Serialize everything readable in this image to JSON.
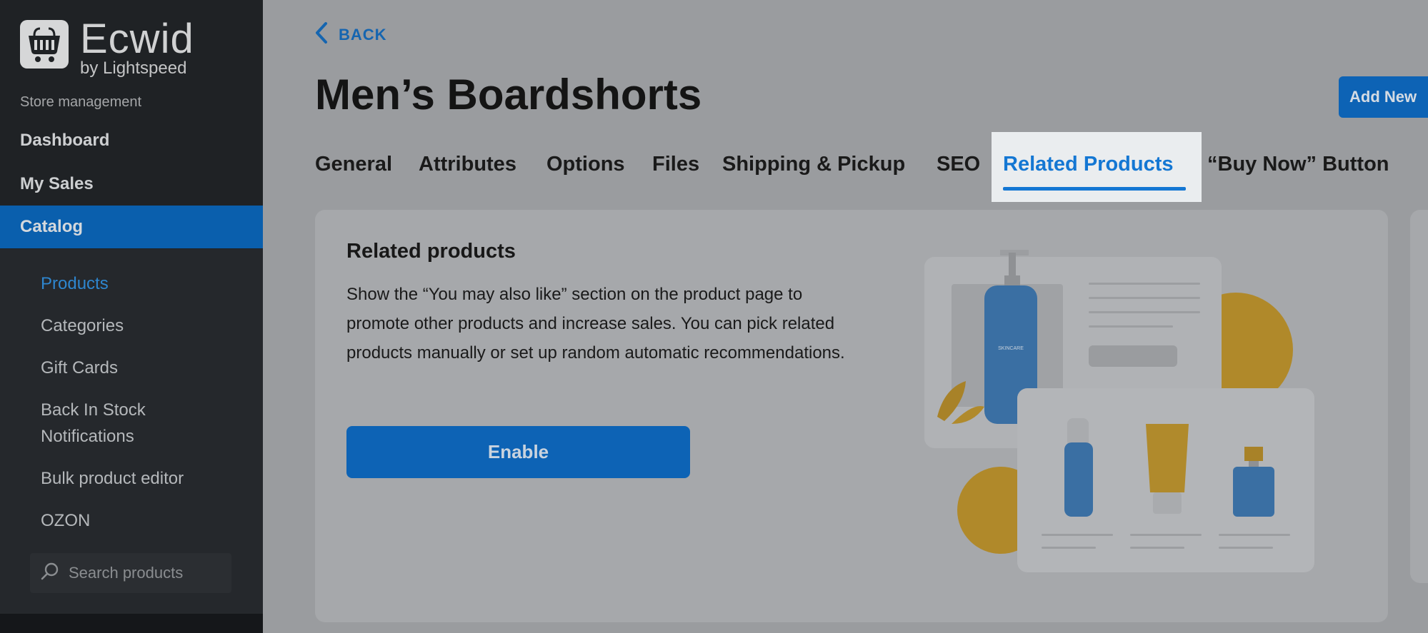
{
  "app": {
    "logo_word": "Ecwid",
    "logo_sub": "by Lightspeed",
    "section_label": "Store management"
  },
  "sidebar": {
    "items": [
      {
        "label": "Dashboard"
      },
      {
        "label": "My Sales"
      },
      {
        "label": "Catalog"
      }
    ],
    "subitems": [
      {
        "label": "Products"
      },
      {
        "label": "Categories"
      },
      {
        "label": "Gift Cards"
      },
      {
        "label": "Back In Stock"
      },
      {
        "label": "Notifications"
      },
      {
        "label": "Bulk product editor"
      },
      {
        "label": "OZON"
      }
    ],
    "search_placeholder": "Search products"
  },
  "header": {
    "back_label": "BACK",
    "title": "Men’s Boardshorts",
    "add_new_label": "Add New"
  },
  "tabs": [
    {
      "label": "General"
    },
    {
      "label": "Attributes"
    },
    {
      "label": "Options"
    },
    {
      "label": "Files"
    },
    {
      "label": "Shipping & Pickup"
    },
    {
      "label": "SEO"
    },
    {
      "label": "Related Products"
    },
    {
      "label": "“Buy Now” Button"
    }
  ],
  "card": {
    "title": "Related products",
    "description": "Show the “You may also like” section on the product page to promote other products and increase sales. You can pick related products manually or set up random automatic recommendations.",
    "enable_label": "Enable"
  },
  "colors": {
    "accent": "#1477d3",
    "sidebar_bg": "#1f2225",
    "active_nav": "#0a5fad"
  }
}
